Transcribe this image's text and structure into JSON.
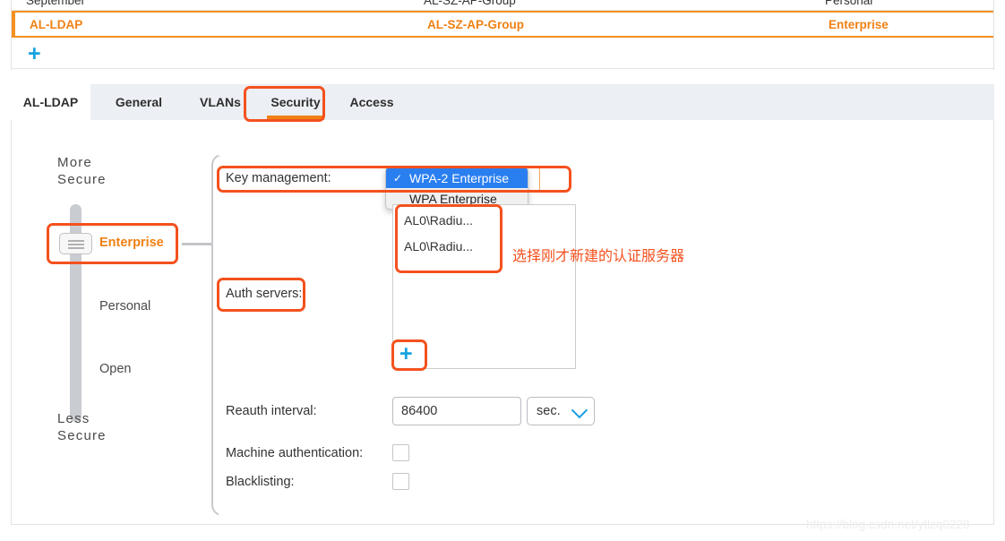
{
  "table": {
    "rows": [
      {
        "name": "September",
        "group": "AL-SZ-AP-Group",
        "security": "Personal",
        "selected": false
      },
      {
        "name": "AL-LDAP",
        "group": "AL-SZ-AP-Group",
        "security": "Enterprise",
        "selected": true
      }
    ],
    "add_label": "+"
  },
  "tabs": [
    {
      "label": "AL-LDAP",
      "active": true
    },
    {
      "label": "General",
      "active": false
    },
    {
      "label": "VLANs",
      "active": false
    },
    {
      "label": "Security",
      "active": false,
      "highlighted": true
    },
    {
      "label": "Access",
      "active": false
    }
  ],
  "security_slider": {
    "top_label": "More\nSecure",
    "top_label_line1": "More",
    "top_label_line2": "Secure",
    "bottom_label_line1": "Less",
    "bottom_label_line2": "Secure",
    "levels": [
      {
        "label": "Enterprise",
        "selected": true
      },
      {
        "label": "Personal",
        "selected": false
      },
      {
        "label": "Open",
        "selected": false
      }
    ]
  },
  "form": {
    "key_management": {
      "label": "Key management:",
      "selected_value": "WPA-2 Enterprise",
      "open": true,
      "options": [
        {
          "label": "WPA-2 Enterprise",
          "checked": true
        },
        {
          "label": "WPA Enterprise",
          "checked": false
        }
      ],
      "check_glyph": "✓"
    },
    "auth_servers": {
      "label": "Auth servers:",
      "items": [
        "AL0\\Radiu...",
        "AL0\\Radiu..."
      ],
      "add_label": "+"
    },
    "reauth_interval": {
      "label": "Reauth interval:",
      "value": "86400",
      "placeholder": "",
      "unit": "sec."
    },
    "machine_authentication": {
      "label": "Machine authentication:",
      "checked": false
    },
    "blacklisting": {
      "label": "Blacklisting:",
      "checked": false
    }
  },
  "annotation": {
    "note": "选择刚才新建的认证服务器",
    "color": "#f4511e"
  },
  "watermark": "https://blog.csdn.net/ytlzq0228",
  "colors": {
    "accent_orange": "#f08013",
    "highlight_red": "#f4511e",
    "link_blue": "#16a3e0",
    "select_blue": "#2a7ff0",
    "tabbar_bg": "#eceff3"
  }
}
